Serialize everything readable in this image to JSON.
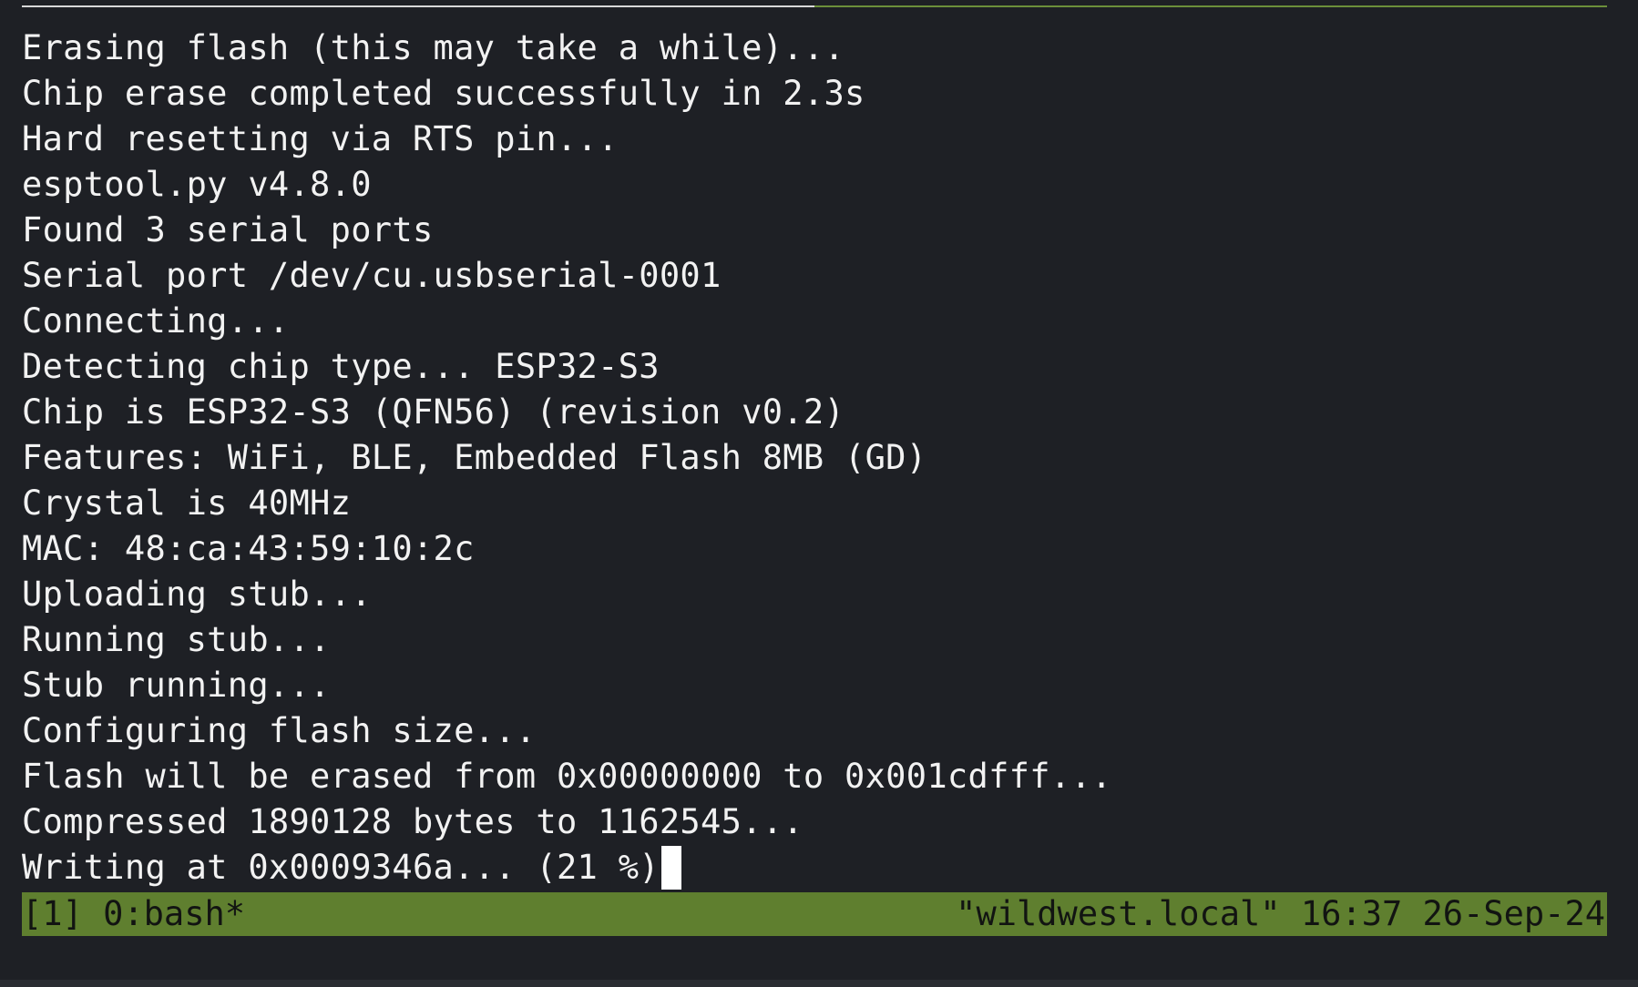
{
  "terminal": {
    "lines": [
      "Erasing flash (this may take a while)...",
      "Chip erase completed successfully in 2.3s",
      "Hard resetting via RTS pin...",
      "esptool.py v4.8.0",
      "Found 3 serial ports",
      "Serial port /dev/cu.usbserial-0001",
      "Connecting...",
      "Detecting chip type... ESP32-S3",
      "Chip is ESP32-S3 (QFN56) (revision v0.2)",
      "Features: WiFi, BLE, Embedded Flash 8MB (GD)",
      "Crystal is 40MHz",
      "MAC: 48:ca:43:59:10:2c",
      "Uploading stub...",
      "Running stub...",
      "Stub running...",
      "Configuring flash size...",
      "Flash will be erased from 0x00000000 to 0x001cdfff...",
      "Compressed 1890128 bytes to 1162545...",
      "Writing at 0x0009346a... (21 %)"
    ]
  },
  "statusbar": {
    "left": "[1] 0:bash*",
    "right": "\"wildwest.local\" 16:37 26-Sep-24"
  },
  "colors": {
    "background": "#1e2025",
    "text": "#f2f2f2",
    "statusbar_bg": "#5f7f2f",
    "statusbar_text": "#121412"
  }
}
